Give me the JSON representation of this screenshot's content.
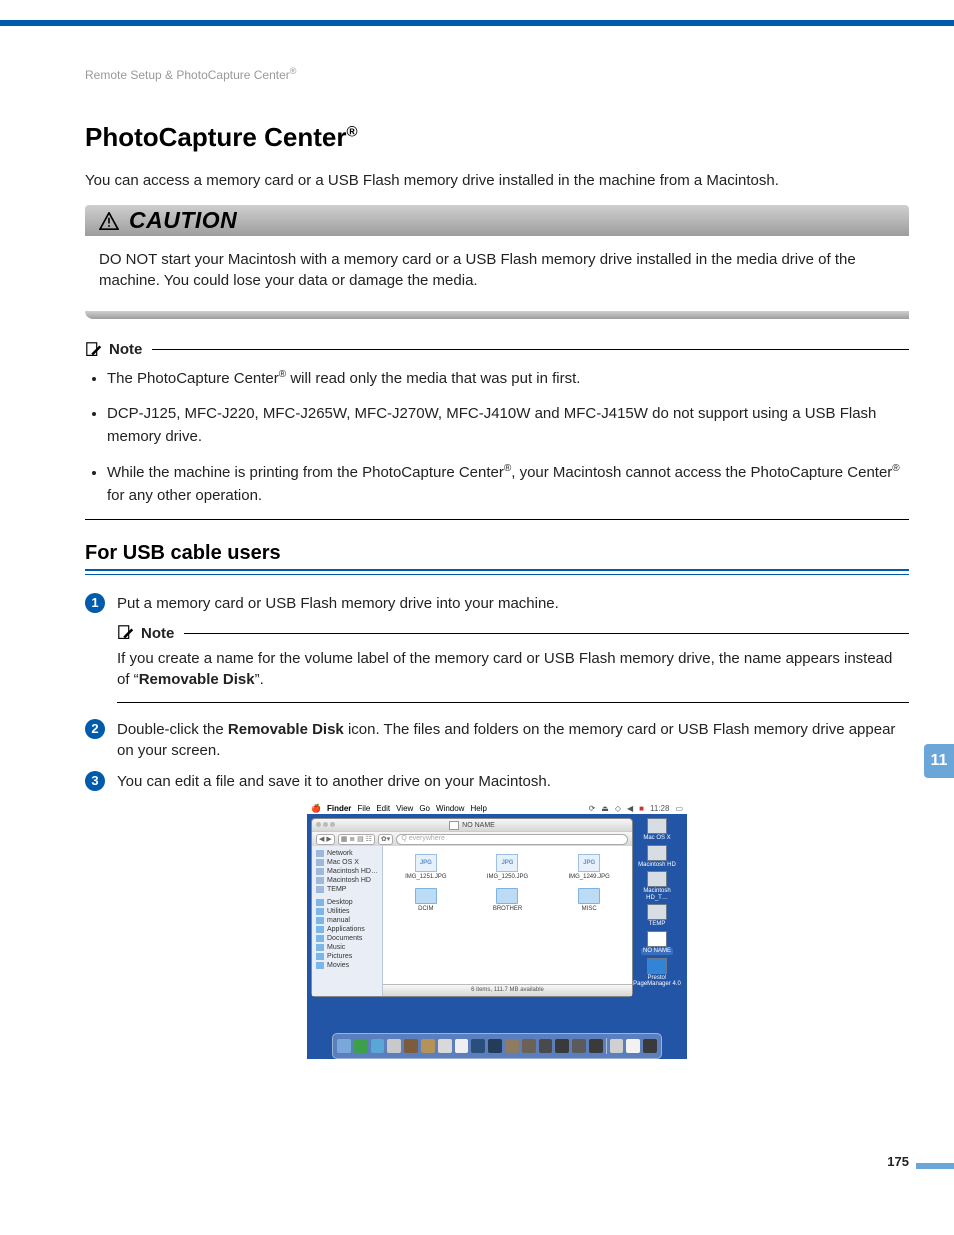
{
  "running_head": "Remote Setup & PhotoCapture Center",
  "title": "PhotoCapture Center",
  "intro": "You can access a memory card or a USB Flash memory drive installed in the machine from a Macintosh.",
  "caution_label": "CAUTION",
  "caution_text": "DO NOT start your Macintosh with a memory card or a USB Flash memory drive installed in the media drive of the machine. You could lose your data or damage the media.",
  "note_label": "Note",
  "notes": [
    "The PhotoCapture Center® will read only the media that was put in first.",
    "DCP-J125, MFC-J220, MFC-J265W, MFC-J270W, MFC-J410W and MFC-J415W do not support using a USB Flash memory drive.",
    "While the machine is printing from the PhotoCapture Center®, your Macintosh cannot access the PhotoCapture Center® for any other operation."
  ],
  "sub_heading": "For USB cable users",
  "steps": {
    "s1": "Put a memory card or USB Flash memory drive into your machine.",
    "s2_pre": "Double-click the ",
    "s2_bold": "Removable Disk",
    "s2_post": " icon. The files and folders on the memory card or USB Flash memory drive appear on your screen.",
    "s3": "You can edit a file and save it to another drive on your Macintosh."
  },
  "inner_note_pre": "If you create a name for the volume label of the memory card or USB Flash memory drive, the name appears instead of “",
  "inner_note_bold": "Removable Disk",
  "inner_note_post": "”.",
  "chapter": "11",
  "page_number": "175",
  "mac": {
    "menu_app": "Finder",
    "menu_items": [
      "File",
      "Edit",
      "View",
      "Go",
      "Window",
      "Help"
    ],
    "menu_time": "11:28",
    "window_title": "NO NAME",
    "toolbar_search_placeholder": "Q  everywhere",
    "sidebar": {
      "devices": [
        "Network",
        "Mac OS X",
        "Macintosh HD…",
        "Macintosh HD",
        "TEMP"
      ],
      "places": [
        "Desktop",
        "Utilities",
        "manual",
        "Applications",
        "Documents",
        "Music",
        "Pictures",
        "Movies"
      ]
    },
    "files": {
      "images": [
        "IMG_1251.JPG",
        "IMG_1250.JPG",
        "IMG_1249.JPG"
      ],
      "folders": [
        "DCIM",
        "BROTHER",
        "MISC"
      ]
    },
    "status": "6 items, 111.7 MB available",
    "desktop": [
      "Mac OS X",
      "Macintosh HD",
      "Macintosh HD_T…",
      "TEMP",
      "NO NAME",
      "Presto! PageManager 4.0"
    ]
  }
}
